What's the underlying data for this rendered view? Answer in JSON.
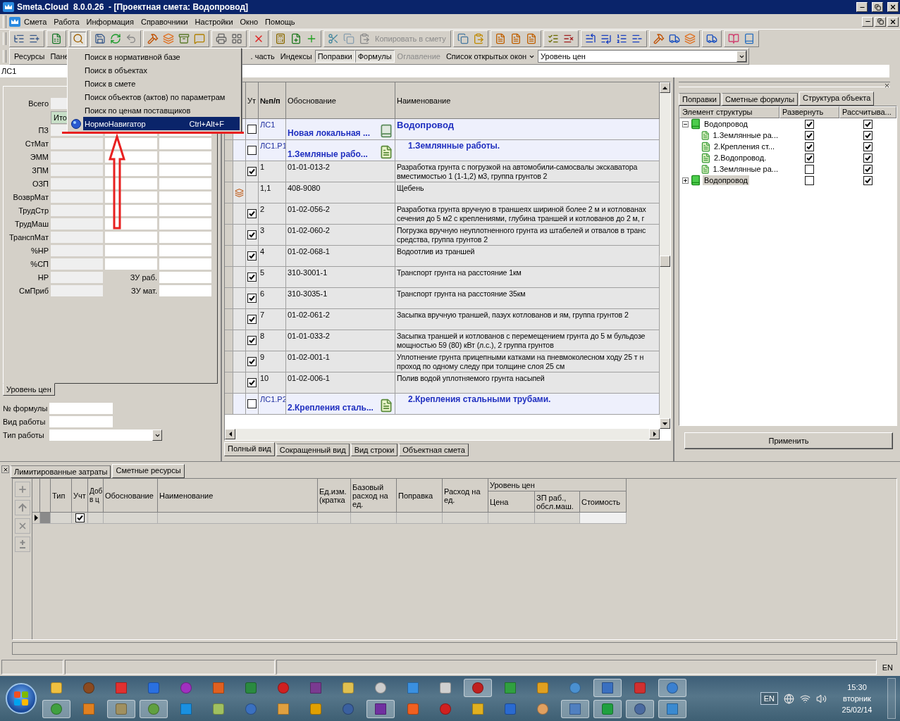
{
  "window": {
    "title": "Smeta.Cloud  8.0.0.26  - [Проектная смета: Водопровод]"
  },
  "menu": [
    "Смета",
    "Работа",
    "Информация",
    "Справочники",
    "Настройки",
    "Окно",
    "Помощь"
  ],
  "toolbar": {
    "copy_label": "Копировать в смету"
  },
  "search_menu": {
    "open": true,
    "items": [
      {
        "label": "Поиск в нормативной базе",
        "selected": false,
        "has_icon": false
      },
      {
        "label": "Поиск в объектах",
        "selected": false,
        "has_icon": false
      },
      {
        "label": "Поиск в смете",
        "selected": false,
        "has_icon": false
      },
      {
        "label": "Поиск объектов (актов) по параметрам",
        "selected": false,
        "has_icon": false
      },
      {
        "label": "Поиск по ценам поставщиков",
        "selected": false,
        "has_icon": false
      },
      {
        "label": "НормоНавигатор",
        "shortcut": "Ctrl+Alt+F",
        "selected": true,
        "has_icon": true
      }
    ]
  },
  "panel_bar": {
    "buttons": [
      {
        "label": "Ресурсы",
        "pressed": false,
        "disabled": false
      },
      {
        "label": "Пане",
        "pressed": false,
        "disabled": false
      },
      {
        "label": ". часть",
        "pressed": false,
        "disabled": false
      },
      {
        "label": "Индексы",
        "pressed": false,
        "disabled": false
      },
      {
        "label": "Поправки",
        "pressed": true,
        "disabled": false
      },
      {
        "label": "Формулы",
        "pressed": true,
        "disabled": false
      },
      {
        "label": "Оглавление",
        "pressed": false,
        "disabled": true
      }
    ],
    "windows_list": "Список открытых окон",
    "price_level": "Уровень цен"
  },
  "address": "ЛС1",
  "totals": {
    "total_label": "Всего",
    "itogo_button": "Ито",
    "rows": [
      {
        "label": "ПЗ"
      },
      {
        "label": "СтМат"
      },
      {
        "label": "ЭММ"
      },
      {
        "label": "ЗПМ"
      },
      {
        "label": "ОЗП"
      },
      {
        "label": "ВозврМат"
      },
      {
        "label": "ТрудСтр"
      },
      {
        "label": "ТрудМаш"
      },
      {
        "label": "ТранспМат"
      },
      {
        "label": "%НР"
      },
      {
        "label": "%СП"
      },
      {
        "label": "НР",
        "side_label": "ЗУ раб."
      },
      {
        "label": "СмПриб",
        "side_label": "ЗУ мат."
      }
    ],
    "tab": "Уровень цен"
  },
  "work_form": {
    "fields": [
      {
        "label": "№ формулы",
        "kind": "text"
      },
      {
        "label": "Вид работы",
        "kind": "text"
      },
      {
        "label": "Тип работы",
        "kind": "dropdown"
      }
    ]
  },
  "estimate_table": {
    "columns": [
      "Ут",
      "№п/п",
      "Обоснование",
      "Наименование"
    ],
    "rows": [
      {
        "kind": "estimate",
        "checked": false,
        "num": "ЛС1",
        "code": "Новая локальная ...",
        "name": "Водопровод"
      },
      {
        "kind": "section",
        "checked": false,
        "num": "ЛС1.Р1",
        "code": "1.Земляные рабо...",
        "name": "1.Землянные работы."
      },
      {
        "kind": "work",
        "checked": true,
        "num": "1",
        "code": "01-01-013-2",
        "name": "Разработка грунта с погрузкой на автомобили-самосвалы экскаватора\nвместимостью 1 (1-1,2) м3, группа грунтов 2"
      },
      {
        "kind": "resource",
        "num": "1,1",
        "code": "408-9080",
        "name": "Щебень"
      },
      {
        "kind": "work",
        "checked": true,
        "num": "2",
        "code": "01-02-056-2",
        "name": "Разработка грунта вручную в траншеях шириной более 2 м и котлованах\nсечения до 5 м2 с креплениями, глубина траншей и котлованов до 2 м, г"
      },
      {
        "kind": "work",
        "checked": true,
        "num": "3",
        "code": "01-02-060-2",
        "name": "Погрузка вручную неуплотненного грунта из штабелей и отвалов в транс\nсредства, группа грунтов 2"
      },
      {
        "kind": "work",
        "checked": true,
        "num": "4",
        "code": "01-02-068-1",
        "name": "Водоотлив из траншей"
      },
      {
        "kind": "work",
        "checked": true,
        "num": "5",
        "code": "310-3001-1",
        "name": "Транспорт грунта на расстояние 1км"
      },
      {
        "kind": "work",
        "checked": true,
        "num": "6",
        "code": "310-3035-1",
        "name": "Транспорт грунта на расстояние 35км"
      },
      {
        "kind": "work",
        "checked": true,
        "num": "7",
        "code": "01-02-061-2",
        "name": "Засыпка вручную траншей, пазух котлованов и ям, группа грунтов 2"
      },
      {
        "kind": "work",
        "checked": true,
        "num": "8",
        "code": "01-01-033-2",
        "name": "Засыпка траншей и котлованов с перемещением грунта до 5 м бульдозе\nмощностью 59 (80) кВт (л.с.), 2 группа грунтов"
      },
      {
        "kind": "work",
        "checked": true,
        "num": "9",
        "code": "01-02-001-1",
        "name": "Уплотнение грунта прицепными катками на пневмоколесном ходу 25 т н\nпроход по одному следу при толщине слоя 25 см"
      },
      {
        "kind": "work",
        "checked": true,
        "num": "10",
        "code": "01-02-006-1",
        "name": "Полив водой уплотняемого грунта насыпей"
      },
      {
        "kind": "section",
        "checked": false,
        "num": "ЛС1.Р2",
        "code": "2.Крепления сталь...",
        "name": "2.Крепления стальными трубами."
      }
    ],
    "view_tabs": [
      {
        "label": "Полный вид",
        "selected": true
      },
      {
        "label": "Сокращенный вид",
        "selected": false
      },
      {
        "label": "Вид строки",
        "selected": false
      },
      {
        "label": "Объектная смета",
        "selected": false
      }
    ]
  },
  "right_panel": {
    "tabs": [
      {
        "label": "Поправки",
        "selected": false
      },
      {
        "label": "Сметные формулы",
        "selected": false
      },
      {
        "label": "Структура объекта",
        "selected": true
      }
    ],
    "tree_columns": [
      "Элемент структуры",
      "Развернуть",
      "Рассчитыва..."
    ],
    "tree": [
      {
        "label": "Водопровод",
        "expanded": true,
        "selected": false,
        "expand_checked": true,
        "calc_checked": true,
        "children": [
          {
            "label": "1.Землянные ра...",
            "selected": false,
            "expand_checked": true,
            "calc_checked": true
          },
          {
            "label": "2.Крепления ст...",
            "selected": false,
            "expand_checked": true,
            "calc_checked": true
          },
          {
            "label": "2.Водопровод.",
            "selected": false,
            "expand_checked": true,
            "calc_checked": true
          },
          {
            "label": "1.Землянные ра...",
            "selected": false,
            "expand_checked": false,
            "calc_checked": true
          }
        ]
      },
      {
        "label": "Водопровод",
        "expanded": false,
        "selected": true,
        "expand_checked": false,
        "calc_checked": true
      }
    ],
    "apply_button": "Применить"
  },
  "bottom_panel": {
    "tabs": [
      {
        "label": "Лимитированные затраты",
        "selected": false
      },
      {
        "label": "Сметные ресурсы",
        "selected": true
      }
    ],
    "columns": [
      "Тип",
      "Учт",
      "Доб\nв ц",
      "Обоснование",
      "Наименование",
      "Ед.изм. (кратка",
      "Базовый расход на ед.",
      "Поправка",
      "Расход на ед."
    ],
    "price_group": {
      "title": "Уровень цен",
      "columns": [
        "Цена",
        "ЗП раб., обсл.маш.",
        "Стоимость"
      ]
    },
    "rows": [
      {
        "selected": true,
        "counted": true
      }
    ]
  },
  "status_bar": {
    "language": "EN"
  },
  "taskbar": {
    "language": "EN",
    "time": "15:30",
    "weekday": "вторник",
    "date": "25/02/14"
  }
}
